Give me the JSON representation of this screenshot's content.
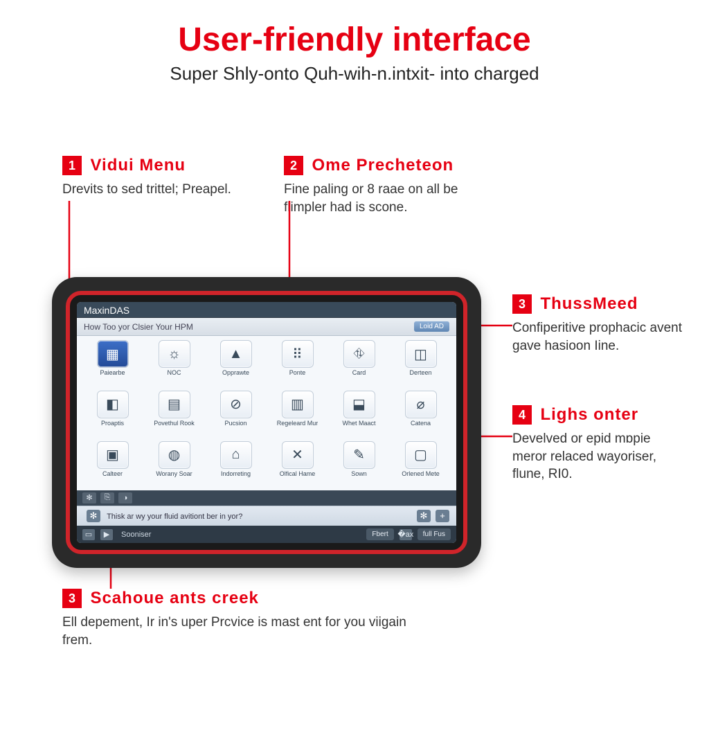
{
  "title": "User-friendly interface",
  "subtitle": "Super Shly-onto Quh-wih-n.intxit- into charged",
  "callouts": [
    {
      "n": "1",
      "title": "Vidui Menu",
      "body": "Drevits to sed trittel; Preapel."
    },
    {
      "n": "2",
      "title": "Ome Precheteon",
      "body": "Fine paling or 8 raae on all be flimpler had is scone."
    },
    {
      "n": "3",
      "title": "ThussMeed",
      "body": "Confiperitive prophacic avent gave hasioon Iine."
    },
    {
      "n": "4",
      "title": "Lighs onter",
      "body": "Develved or epid mɒpie meror relaced wayoriser, flune, RI0."
    },
    {
      "n": "3",
      "title": "Scahoue ants creek",
      "body": "Ell depement, Ir in's uper Prcvice is mast ent for you viigain frem."
    }
  ],
  "device": {
    "brand": "MaxinDAS",
    "subbar_text": "How Too yor Clsier Your HPM",
    "subbar_button": "Loid AD",
    "msgbar_left_icon": "✻",
    "msgbar_text": "Thisk ar wy your fluid avitiont ber in yor?",
    "msgbar_gear": "✻",
    "msgbar_plus": "+",
    "footer": {
      "doc_icon": "▭",
      "play_icon": "▶",
      "brand_label": "Sooniser",
      "btn1": "Fbert",
      "share_icon": "�ах",
      "btn2": "full Fus"
    },
    "gear_icons": [
      "✻",
      "⎘",
      "◑"
    ],
    "apps": [
      {
        "label": "Paiearbe",
        "glyph": "▦"
      },
      {
        "label": "NOC",
        "glyph": "☼"
      },
      {
        "label": "Opprawte",
        "glyph": "▲"
      },
      {
        "label": "Ponte",
        "glyph": "⠿"
      },
      {
        "label": "Card",
        "glyph": "⛗"
      },
      {
        "label": "Derteen",
        "glyph": "◫"
      },
      {
        "label": "Proaptis",
        "glyph": "◧"
      },
      {
        "label": "Povethul Rook",
        "glyph": "▤"
      },
      {
        "label": "Pucsion",
        "glyph": "⊘"
      },
      {
        "label": "Regeleard Mur",
        "glyph": "▥"
      },
      {
        "label": "Whet Maact",
        "glyph": "⬓"
      },
      {
        "label": "Catena",
        "glyph": "⌀"
      },
      {
        "label": "Calteer",
        "glyph": "▣"
      },
      {
        "label": "Worany Soar",
        "glyph": "◍"
      },
      {
        "label": "Indorreting",
        "glyph": "⌂"
      },
      {
        "label": "Olfical Hame",
        "glyph": "✕"
      },
      {
        "label": "Sown",
        "glyph": "✎"
      },
      {
        "label": "Orlened Mete",
        "glyph": "▢"
      }
    ]
  }
}
